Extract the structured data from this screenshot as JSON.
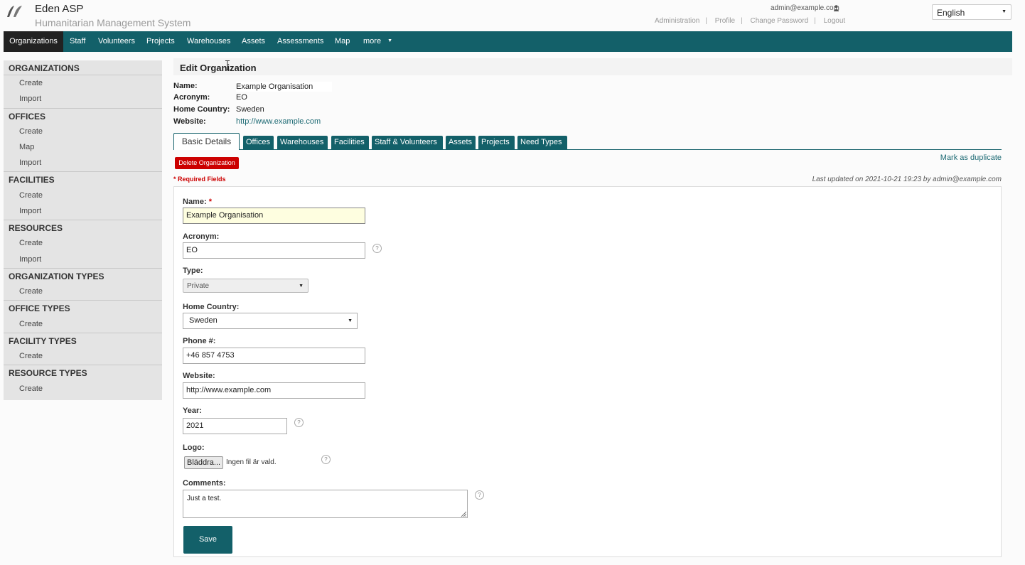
{
  "header": {
    "app_title": "Eden ASP",
    "app_subtitle": "Humanitarian Management System",
    "user_email": "admin@example.com",
    "auth_links": [
      "Administration",
      "Profile",
      "Change Password",
      "Logout"
    ],
    "language": "English"
  },
  "nav": {
    "items": [
      "Organizations",
      "Staff",
      "Volunteers",
      "Projects",
      "Warehouses",
      "Assets",
      "Assessments",
      "Map",
      "more"
    ],
    "active": "Organizations"
  },
  "sidebar": {
    "organizations": {
      "title": "ORGANIZATIONS",
      "items": [
        "Create",
        "Import"
      ]
    },
    "offices": {
      "title": "OFFICES",
      "items": [
        "Create",
        "Map",
        "Import"
      ]
    },
    "facilities": {
      "title": "FACILITIES",
      "items": [
        "Create",
        "Import"
      ]
    },
    "resources": {
      "title": "RESOURCES",
      "items": [
        "Create",
        "Import"
      ]
    },
    "organization_types": {
      "title": "ORGANIZATION TYPES",
      "items": [
        "Create"
      ]
    },
    "office_types": {
      "title": "OFFICE TYPES",
      "items": [
        "Create"
      ]
    },
    "facility_types": {
      "title": "FACILITY TYPES",
      "items": [
        "Create"
      ]
    },
    "resource_types": {
      "title": "RESOURCE TYPES",
      "items": [
        "Create"
      ]
    }
  },
  "page": {
    "title": "Edit Organization",
    "rheader": {
      "name_label": "Name:",
      "name": "Example Organisation",
      "acronym_label": "Acronym:",
      "acronym": "EO",
      "country_label": "Home Country:",
      "country": "Sweden",
      "website_label": "Website:",
      "website": "http://www.example.com"
    },
    "tabs": [
      "Basic Details",
      "Offices",
      "Warehouses",
      "Facilities",
      "Staff & Volunteers",
      "Assets",
      "Projects",
      "Need Types"
    ],
    "active_tab": "Basic Details",
    "delete_label": "Delete Organization",
    "mark_duplicate": "Mark as duplicate",
    "required_note": "* Required Fields",
    "last_updated": "Last updated on 2021-10-21 19:23 by admin@example.com"
  },
  "form": {
    "name": {
      "label": "Name:",
      "required": "*",
      "value": "Example Organisation"
    },
    "acronym": {
      "label": "Acronym:",
      "value": "EO"
    },
    "type": {
      "label": "Type:",
      "value": "Private"
    },
    "country": {
      "label": "Home Country:",
      "value": "Sweden"
    },
    "phone": {
      "label": "Phone #:",
      "value": "+46 857 4753"
    },
    "website": {
      "label": "Website:",
      "value": "http://www.example.com"
    },
    "year": {
      "label": "Year:",
      "value": "2021"
    },
    "logo": {
      "label": "Logo:",
      "button": "Bläddra...",
      "status": "Ingen fil är vald."
    },
    "comments": {
      "label": "Comments:",
      "value": "Just a test."
    },
    "save_label": "Save"
  },
  "colors": {
    "primary": "#136069",
    "danger": "#cc0000",
    "nav_active": "#222222",
    "sidebar_bg": "#e4e4e4",
    "focus_bg": "#fefee0"
  }
}
